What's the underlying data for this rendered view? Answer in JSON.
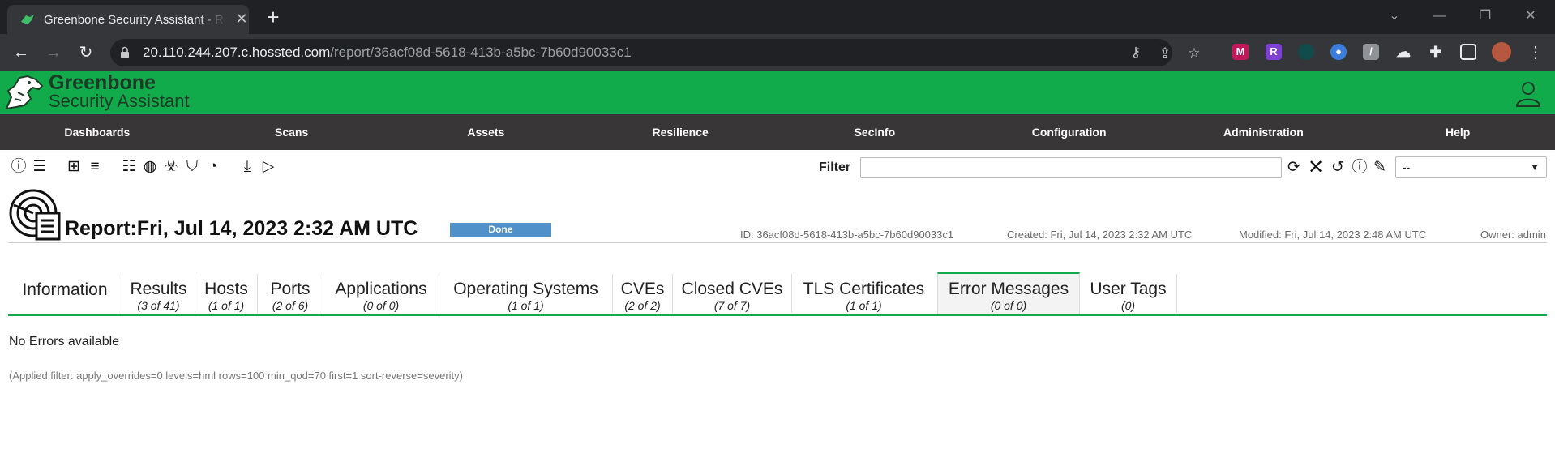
{
  "browser": {
    "tab_title": "Greenbone Security Assistant - Report",
    "url_host": "20.110.244.207.c.hossted.com",
    "url_path": "/report/36acf08d-5618-413b-a5bc-7b60d90033c1"
  },
  "app": {
    "brand_line1": "Greenbone",
    "brand_line2": "Security Assistant",
    "accent": "#11ab4c"
  },
  "nav": [
    "Dashboards",
    "Scans",
    "Assets",
    "Resilience",
    "SecInfo",
    "Configuration",
    "Administration",
    "Help"
  ],
  "filter": {
    "label": "Filter",
    "value": "",
    "select_value": "--"
  },
  "report": {
    "title": "Report:Fri, Jul 14, 2023 2:32 AM UTC",
    "status": "Done",
    "id": "ID: 36acf08d-5618-413b-a5bc-7b60d90033c1",
    "created": "Created: Fri, Jul 14, 2023 2:32 AM UTC",
    "modified": "Modified: Fri, Jul 14, 2023 2:48 AM UTC",
    "owner": "Owner: admin"
  },
  "tabs": [
    {
      "label": "Information",
      "count": ""
    },
    {
      "label": "Results",
      "count": "(3 of 41)"
    },
    {
      "label": "Hosts",
      "count": "(1 of 1)"
    },
    {
      "label": "Ports",
      "count": "(2 of 6)"
    },
    {
      "label": "Applications",
      "count": "(0 of 0)"
    },
    {
      "label": "Operating Systems",
      "count": "(1 of 1)"
    },
    {
      "label": "CVEs",
      "count": "(2 of 2)"
    },
    {
      "label": "Closed CVEs",
      "count": "(7 of 7)"
    },
    {
      "label": "TLS Certificates",
      "count": "(1 of 1)"
    },
    {
      "label": "Error Messages",
      "count": "(0 of 0)"
    },
    {
      "label": "User Tags",
      "count": "(0)"
    }
  ],
  "content": {
    "empty_message": "No Errors available",
    "applied_filter": "(Applied filter: apply_overrides=0 levels=hml rows=100 min_qod=70 first=1 sort-reverse=severity)"
  }
}
